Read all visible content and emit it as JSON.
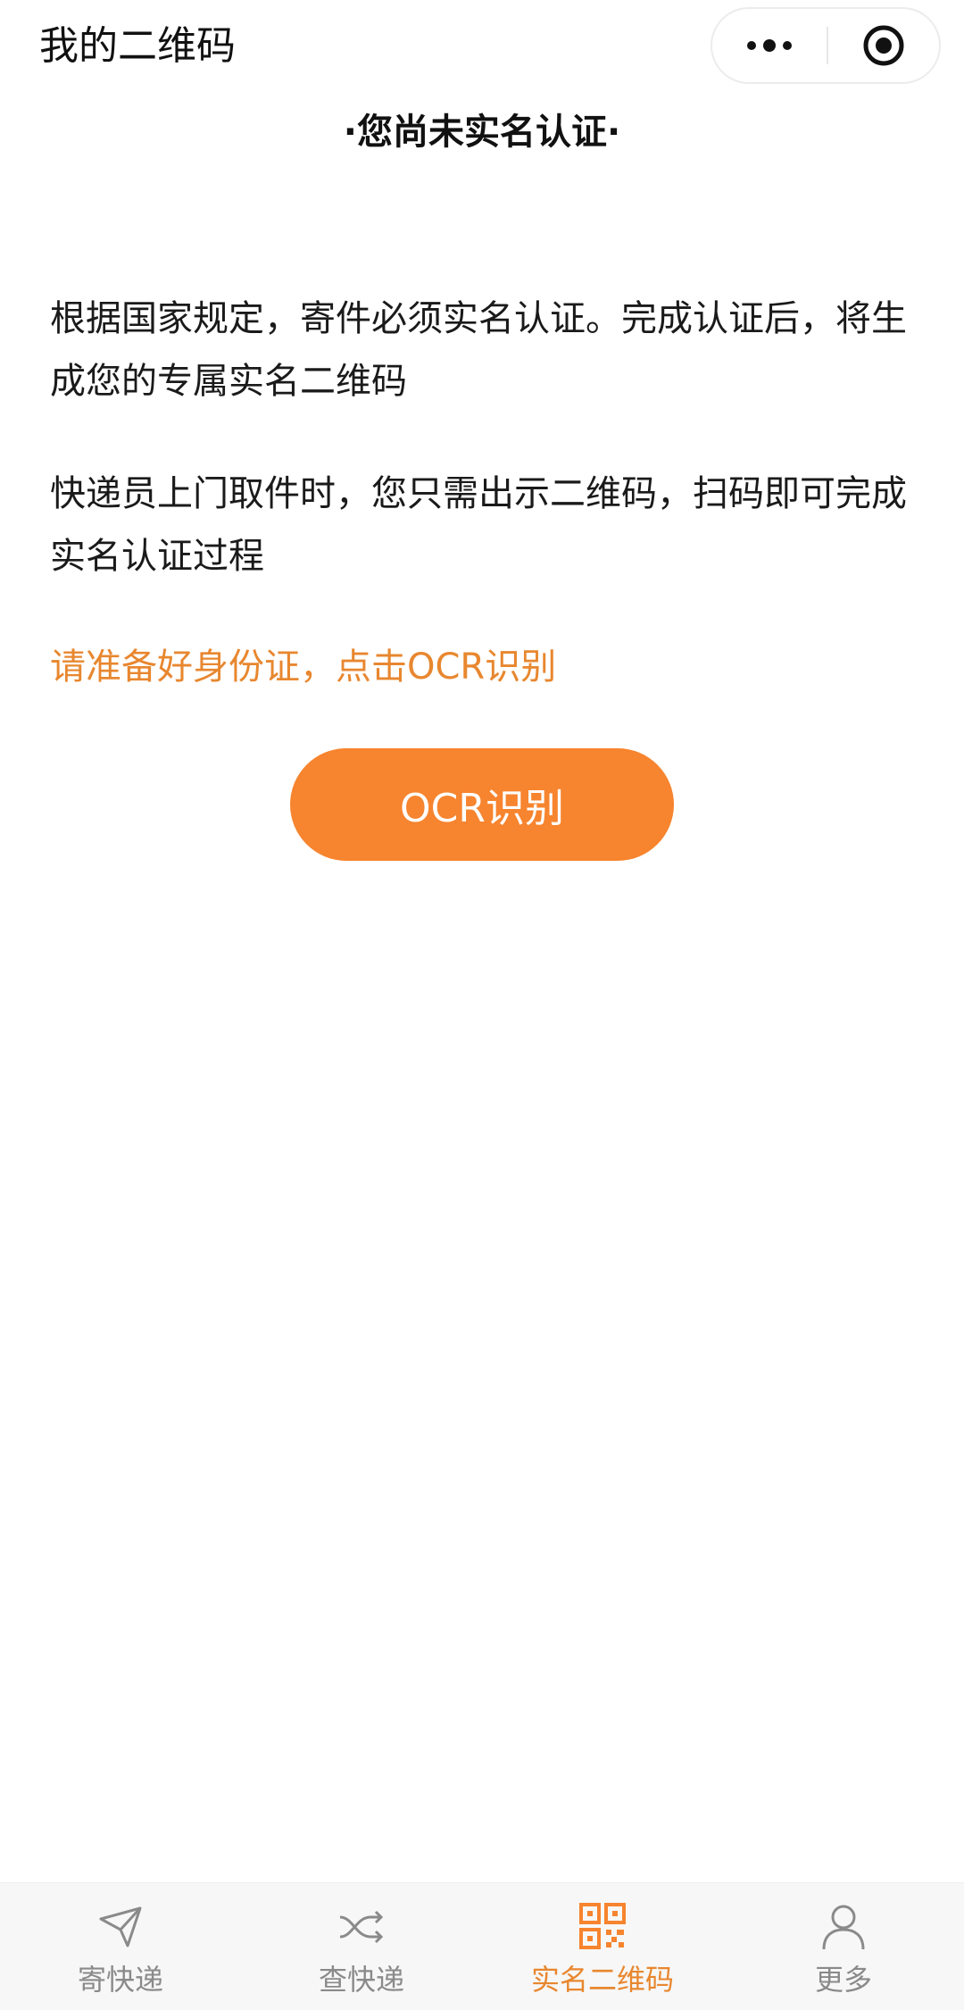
{
  "header": {
    "title": "我的二维码",
    "more_icon": "more-dots-icon",
    "close_icon": "target-circle-icon"
  },
  "notice": {
    "heading": "·您尚未实名认证·",
    "paragraphs": [
      "根据国家规定，寄件必须实名认证。完成认证后，将生成您的专属实名二维码",
      "快递员上门取件时，您只需出示二维码，扫码即可完成实名认证过程"
    ],
    "hint": "请准备好身份证，点击OCR识别",
    "button_label": "OCR识别"
  },
  "tabbar": {
    "active_index": 2,
    "items": [
      {
        "label": "寄快递",
        "icon": "paper-plane-icon"
      },
      {
        "label": "查快递",
        "icon": "shuffle-icon"
      },
      {
        "label": "实名二维码",
        "icon": "qr-code-icon"
      },
      {
        "label": "更多",
        "icon": "user-icon"
      }
    ]
  },
  "colors": {
    "accent": "#f7842e",
    "hint_text": "#e8872f",
    "tab_inactive": "#8a8a8a"
  }
}
